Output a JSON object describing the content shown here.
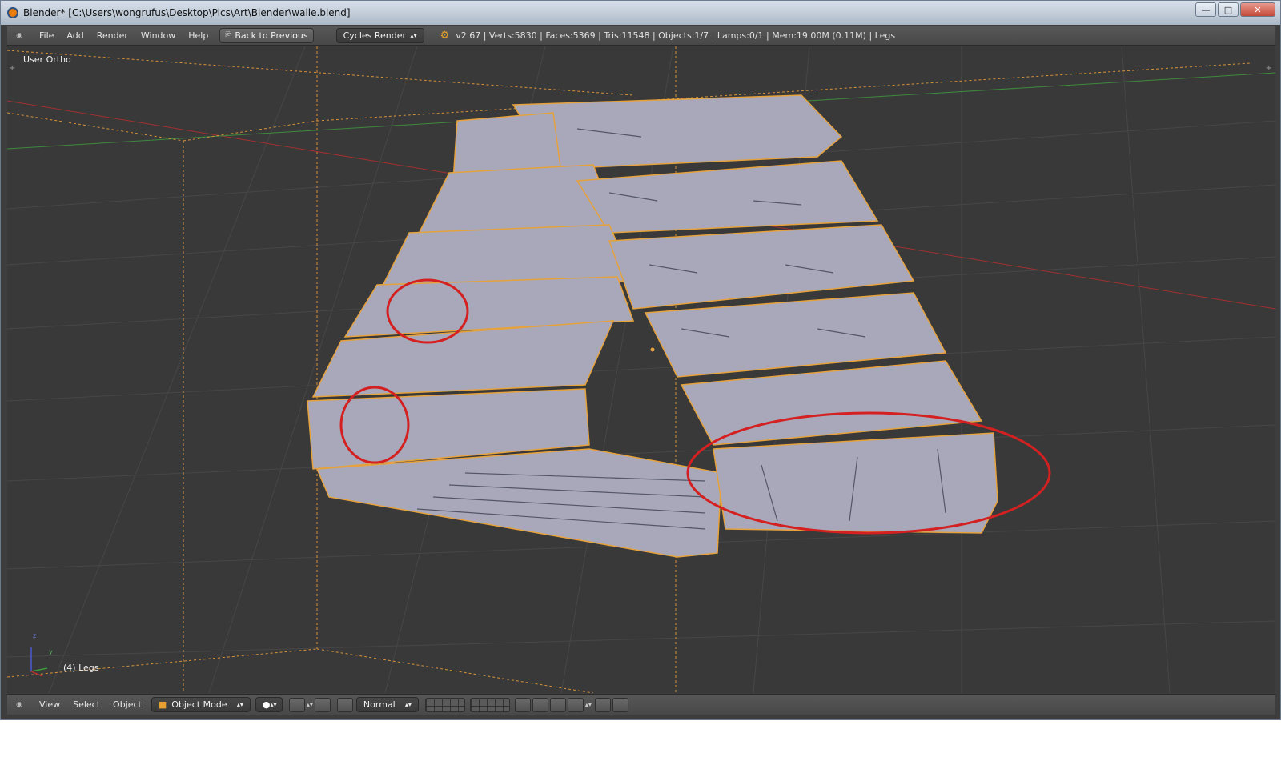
{
  "window": {
    "title": "Blender* [C:\\Users\\wongrufus\\Desktop\\Pics\\Art\\Blender\\walle.blend]",
    "controls": {
      "minimize": "—",
      "maximize": "□",
      "close": "✕"
    }
  },
  "header": {
    "menus": [
      "File",
      "Add",
      "Render",
      "Window",
      "Help"
    ],
    "back_button": "Back to Previous",
    "render_engine": "Cycles Render",
    "stats": "v2.67 | Verts:5830 | Faces:5369 | Tris:11548 | Objects:1/7 | Lamps:0/1 | Mem:19.00M (0.11M) | Legs"
  },
  "viewport": {
    "view_name": "User Ortho",
    "object_info": "(4) Legs",
    "axis_labels": {
      "z": "z",
      "y": "y"
    }
  },
  "footer": {
    "menus": [
      "View",
      "Select",
      "Object"
    ],
    "mode": "Object Mode",
    "orientation": "Normal"
  },
  "colors": {
    "viewport_bg": "#393939",
    "mesh": "#a9a9ba",
    "selection_outline": "#e6a23c",
    "annotation_circle": "#d42020"
  }
}
